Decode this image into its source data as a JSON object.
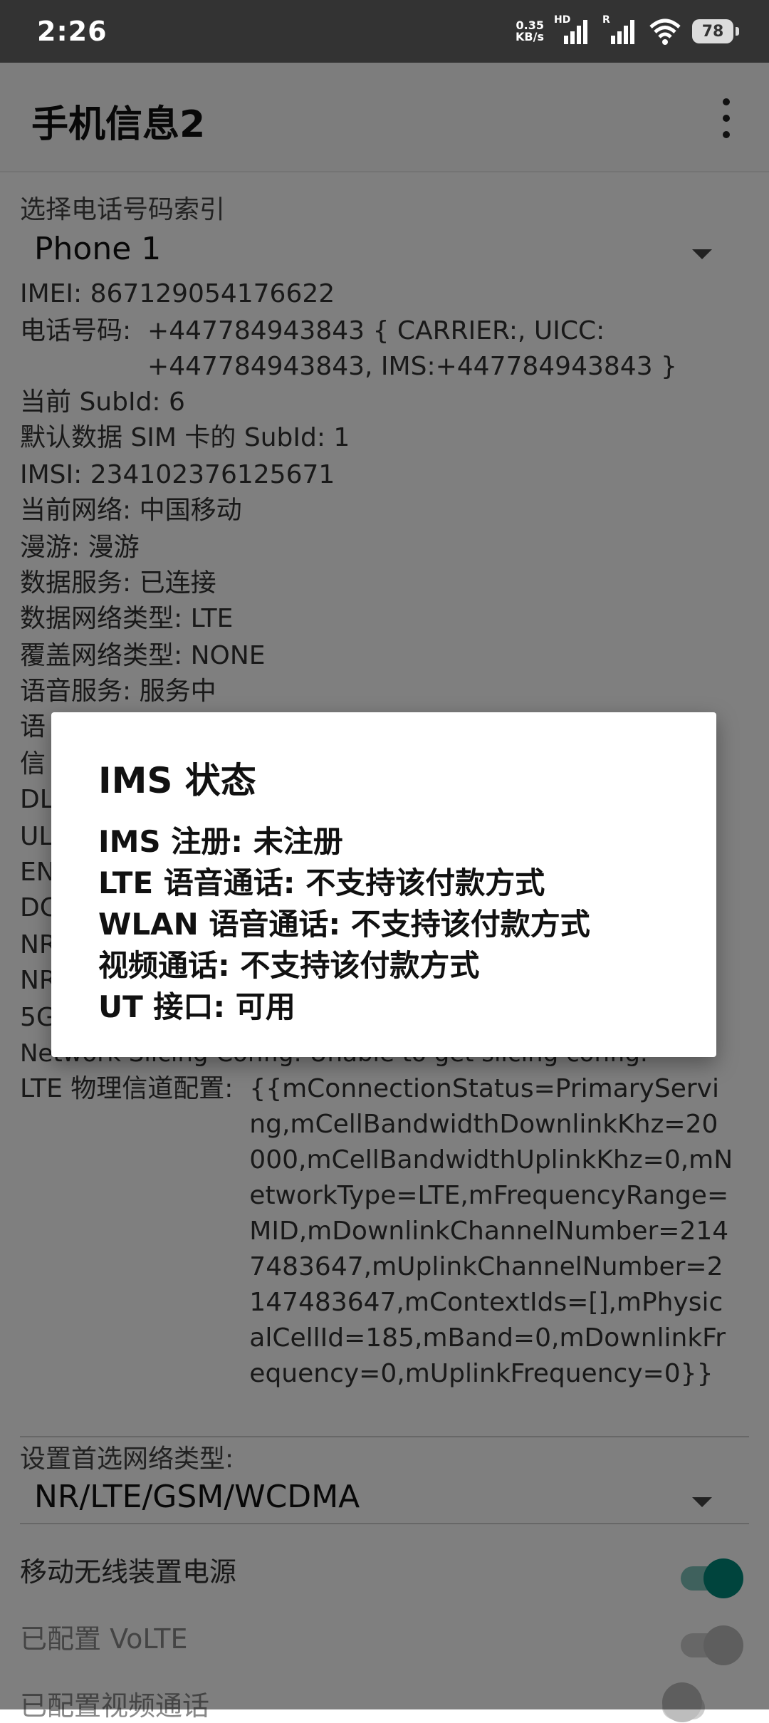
{
  "status": {
    "time": "2:26",
    "net_speed_top": "0.35",
    "net_speed_bottom": "KB/s",
    "hd_label": "HD",
    "roaming_label": "R",
    "battery": "78"
  },
  "app": {
    "title": "手机信息2"
  },
  "phone_index": {
    "label": "选择电话号码索引",
    "selected": "Phone 1"
  },
  "info": {
    "imei": "IMEI:  867129054176622",
    "phone_label": "电话号码:  ",
    "phone_value": "+447784943843 { CARRIER:, UICC: +447784943843, IMS:+447784943843 }",
    "subid": "当前 SubId:  6",
    "default_subid": "默认数据 SIM 卡的 SubId:  1",
    "imsi": "IMSI: 234102376125671",
    "network": "当前网络:  中国移动",
    "roaming": "漫游:  漫游",
    "data_service": "数据服务:  已连接",
    "data_network_type": "数据网络类型:  LTE",
    "overlay_network_type": "覆盖网络类型:  NONE",
    "voice_service": "语音服务:  服务中",
    "hidden_rows": [
      "语",
      "信",
      "DL",
      "UL",
      "EN",
      "DC",
      "NR",
      "NR",
      "5G"
    ],
    "network_slicing": "Network Slicing Config: Unable to get slicing config.",
    "lte_label": "LTE 物理信道配置:  ",
    "lte_value": "{{mConnectionStatus=PrimaryServing,mCellBandwidthDownlinkKhz=20000,mCellBandwidthUplinkKhz=0,mNetworkType=LTE,mFrequencyRange=MID,mDownlinkChannelNumber=2147483647,mUplinkChannelNumber=2147483647,mContextIds=[],mPhysicalCellId=185,mBand=0,mDownlinkFrequency=0,mUplinkFrequency=0}}"
  },
  "preferred_network": {
    "label": "设置首选网络类型:",
    "selected": "NR/LTE/GSM/WCDMA"
  },
  "switches": [
    {
      "label": "移动无线装置电源",
      "on": true
    },
    {
      "label": "已配置 VoLTE",
      "on": false
    },
    {
      "label": "已配置视频通话",
      "on": false
    }
  ],
  "dialog": {
    "title": "IMS 状态",
    "lines": [
      "IMS 注册: 未注册",
      "LTE 语音通话: 不支持该付款方式",
      "WLAN 语音通话: 不支持该付款方式",
      "视频通话: 不支持该付款方式",
      "UT 接口: 可用"
    ]
  },
  "colors": {
    "switch_on": "#00897b",
    "scrim": "rgba(0,0,0,0.5)"
  }
}
